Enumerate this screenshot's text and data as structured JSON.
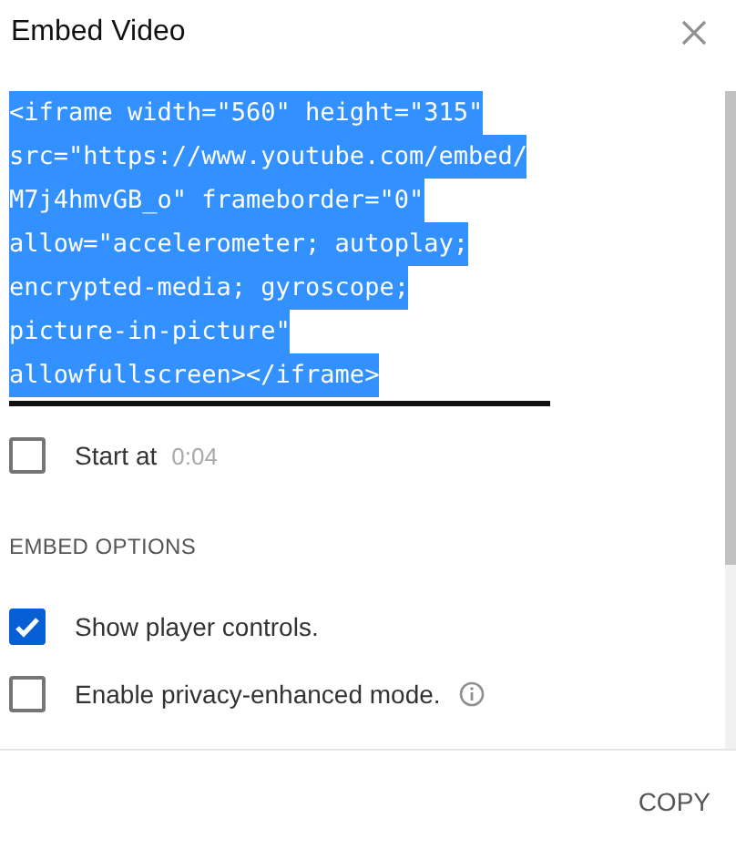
{
  "dialog": {
    "title": "Embed Video"
  },
  "embed_code": {
    "selected": true,
    "lines": [
      "<iframe width=\"560\" height=\"315\"",
      "src=\"https://www.youtube.com/embed/",
      "M7j4hmvGB_o\" frameborder=\"0\"",
      "allow=\"accelerometer; autoplay;",
      "encrypted-media; gyroscope;",
      "picture-in-picture\"",
      "allowfullscreen></iframe>"
    ]
  },
  "start_at": {
    "label": "Start at",
    "checked": false,
    "time": "0:04"
  },
  "section_heading": "EMBED OPTIONS",
  "options": [
    {
      "label": "Show player controls.",
      "checked": true,
      "info": false
    },
    {
      "label": "Enable privacy-enhanced mode.",
      "checked": false,
      "info": true
    }
  ],
  "buttons": [
    "COPY"
  ]
}
